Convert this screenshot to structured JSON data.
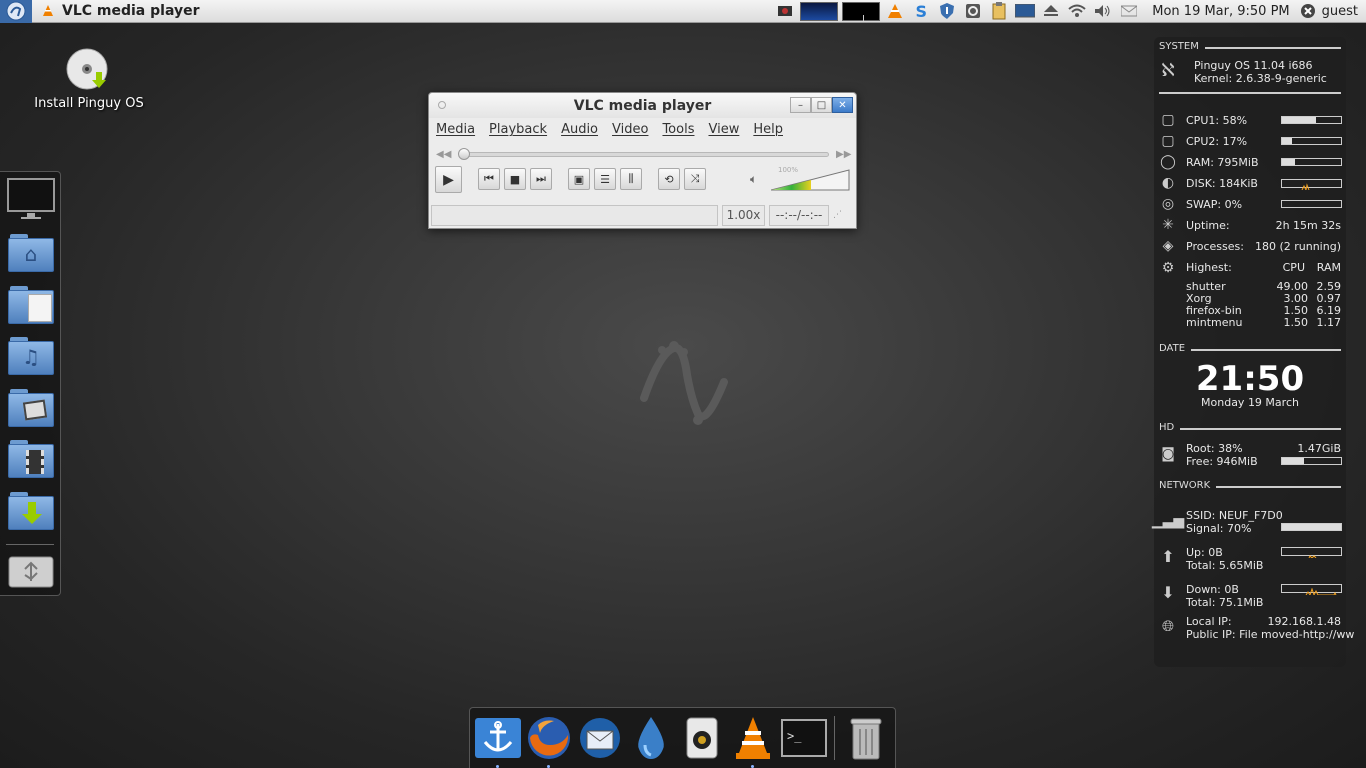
{
  "top_panel": {
    "app_title": "VLC media player",
    "clock": "Mon 19 Mar,  9:50 PM",
    "user": "guest"
  },
  "desktop": {
    "install_icon_label": "Install Pinguy OS"
  },
  "vlc": {
    "title": "VLC media player",
    "menu": [
      "Media",
      "Playback",
      "Audio",
      "Video",
      "Tools",
      "View",
      "Help"
    ],
    "volume_label": "100%",
    "speed": "1.00x",
    "time": "--:--/--:--"
  },
  "conky": {
    "system_header": "SYSTEM",
    "os": "Pinguy OS 11.04 i686",
    "kernel": "Kernel: 2.6.38-9-generic",
    "cpu1": "CPU1: 58%",
    "cpu1_pct": 0.58,
    "cpu2": "CPU2: 17%",
    "cpu2_pct": 0.17,
    "ram": "RAM: 795MiB",
    "ram_pct": 0.22,
    "disk": "DISK: 184KiB",
    "swap": "SWAP: 0%",
    "swap_pct": 0,
    "uptime_label": "Uptime:",
    "uptime_value": "2h 15m 32s",
    "processes_label": "Processes:",
    "processes_value": "180 (2 running)",
    "highest_label": "Highest:",
    "col_cpu": "CPU",
    "col_ram": "RAM",
    "procs": [
      {
        "name": "shutter",
        "cpu": "49.00",
        "ram": "2.59"
      },
      {
        "name": "Xorg",
        "cpu": "3.00",
        "ram": "0.97"
      },
      {
        "name": "firefox-bin",
        "cpu": "1.50",
        "ram": "6.19"
      },
      {
        "name": "mintmenu",
        "cpu": "1.50",
        "ram": "1.17"
      }
    ],
    "date_header": "DATE",
    "time_big": "21:50",
    "date_text": "Monday 19 March",
    "hd_header": "HD",
    "root": "Root: 38%",
    "root_size": "1.47GiB",
    "free": "Free: 946MiB",
    "root_pct": 0.38,
    "network_header": "NETWORK",
    "ssid": "SSID: NEUF_F7D0",
    "signal": "Signal: 70%",
    "signal_pct": 0.7,
    "up": "Up: 0B",
    "up_total": "Total: 5.65MiB",
    "down": "Down: 0B",
    "down_total": "Total: 75.1MiB",
    "local_ip_label": "Local IP:",
    "local_ip": "192.168.1.48",
    "public_ip": "Public IP: File moved-http://ww"
  },
  "icons": {
    "left_dock": [
      "monitor-icon",
      "home-folder-icon",
      "documents-folder-icon",
      "music-folder-icon",
      "pictures-folder-icon",
      "videos-folder-icon",
      "downloads-folder-icon",
      "usb-drive-icon"
    ],
    "bottom_dock": [
      "anchor-icon",
      "firefox-icon",
      "thunderbird-icon",
      "drop-icon",
      "speaker-icon",
      "vlc-icon",
      "terminal-icon",
      "trash-icon"
    ]
  }
}
